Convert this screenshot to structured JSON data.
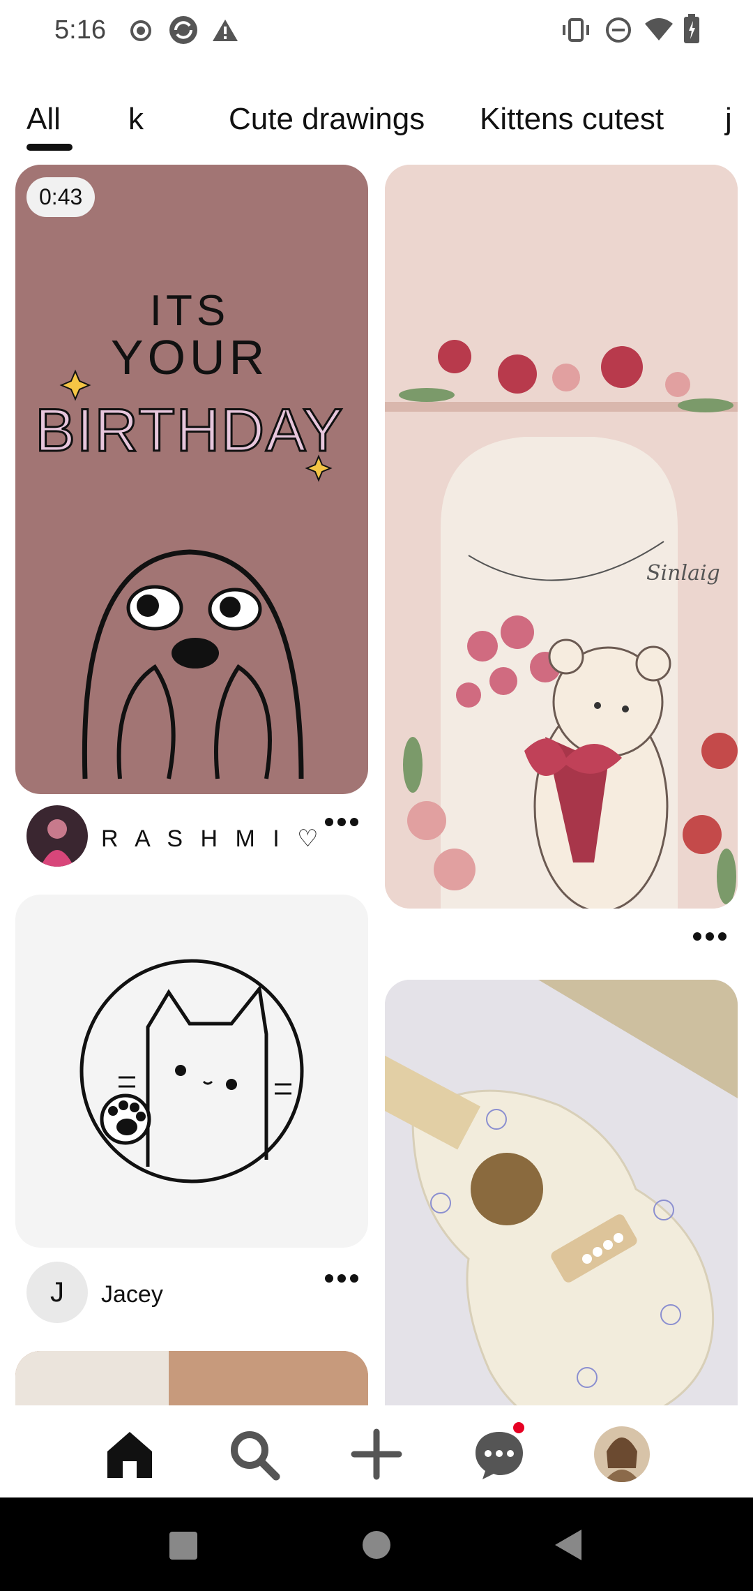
{
  "status_bar": {
    "time": "5:16"
  },
  "tabs": [
    {
      "label": "All",
      "active": true
    },
    {
      "label": "k"
    },
    {
      "label": "Cute drawings"
    },
    {
      "label": "Kittens cutest"
    },
    {
      "label": "j"
    }
  ],
  "pins": [
    {
      "video_duration": "0:43",
      "user": "R A S H M I ♡"
    },
    {
      "user": "Jacey",
      "avatar_initial": "J"
    }
  ],
  "birthday_art": {
    "line1": "ITS",
    "line2": "YOUR",
    "line3": "BIRTHDAY"
  },
  "bear_art": {
    "signature": "Sinlaig"
  },
  "colors": {
    "accent_dot": "#e60023",
    "birthday_bg": "#a27574",
    "pink_bg": "#ecd6cf"
  },
  "bottom_nav": [
    {
      "icon": "home-icon"
    },
    {
      "icon": "search-icon"
    },
    {
      "icon": "plus-icon"
    },
    {
      "icon": "chat-icon",
      "notification": true
    },
    {
      "icon": "profile-avatar"
    }
  ]
}
